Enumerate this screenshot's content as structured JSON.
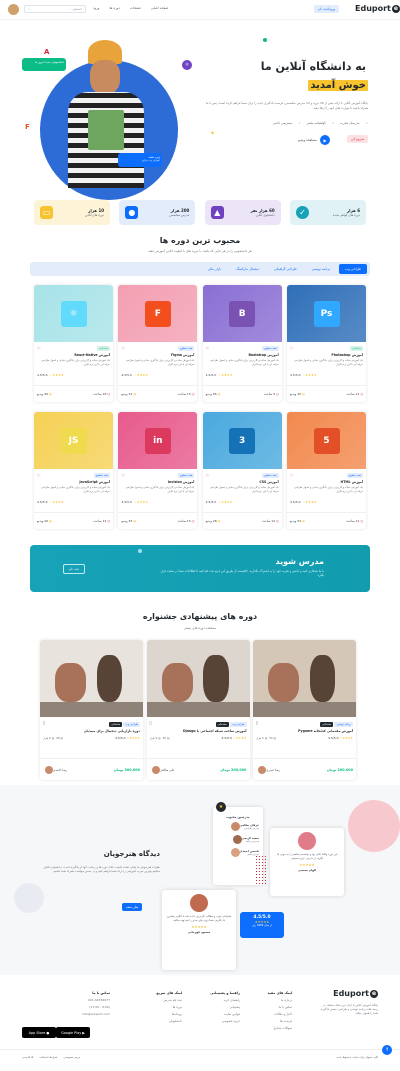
{
  "colors": {
    "primary": "#0d6efd",
    "danger": "#d6293e",
    "warning": "#f7c32e",
    "info": "#17a2b8",
    "purple": "#6f42c1",
    "success": "#0cbc87"
  },
  "header": {
    "logo": "Eduport",
    "login": "ورود/ثبت نام",
    "menu": [
      "صفحه اصلی",
      "صفحات",
      "دوره ها",
      "ورود"
    ],
    "search_placeholder": "جستجو...",
    "login_icon": "user-icon"
  },
  "hero": {
    "title_line1": "به دانشگاه آنلاین ما",
    "title_line2": "خوش آمدید",
    "paragraph": "پایگاه آموزش آنلاین با ارائه بیش از 30 دوره و 12 مدرس متخصص، فرصت یادگیری جدید را برای شما فراهم کرده است؛ پس با ما همراه باشید تا مهارت های خود را ارتقا دهید.",
    "checks": [
      "مدرسان مجرب",
      "گواهینامه معتبر",
      "دسترسی دائمی"
    ],
    "start_button": "شروع کن",
    "video_button": "مشاهده ویدیو",
    "badge_top": "دانشجویان جدید امروز ما",
    "badge_bottom": "دوره هفته",
    "badge_bottom_sub": "آموزش وب دیزاین"
  },
  "stats": [
    {
      "num": "10 هزار",
      "label": "دوره های آنلاین",
      "icon": "tv-icon",
      "color": "#fdf3d7",
      "icon_color": "#f7c32e"
    },
    {
      "num": "200 هزار",
      "label": "مدرس متخصص",
      "icon": "user-icon",
      "color": "#e2ecfb",
      "icon_color": "#0d6efd"
    },
    {
      "num": "60 هزار نفر",
      "label": "دانشجوی آنلاین",
      "icon": "graduation-icon",
      "color": "#ece5f7",
      "icon_color": "#6f42c1"
    },
    {
      "num": "6 هزار",
      "label": "دوره های گواهی شده",
      "icon": "badge-check-icon",
      "color": "#e0f2f5",
      "icon_color": "#17a2b8"
    }
  ],
  "popular": {
    "title": "محبوب ترین دوره ها",
    "subtitle": "هر دانشجویی را در هر جایی که باشد، با دوره های با کیفیت آنلاین آموزش دهید",
    "tabs": [
      "طراحی وب",
      "برنامه نویسی",
      "طراحی گرافیکی",
      "دیجیتال مارکتینگ",
      "بازار مالی"
    ],
    "active_tab": 0,
    "courses": [
      {
        "title": "آموزش Photoshop",
        "level": "مقدماتی",
        "desc": "یک آموزش ساده و کاربردی برای یادگیری مبانی و اصول طراحی حرفه ای با این نرم افزار",
        "rating": "4.5/5.0",
        "hours": "12 ساعت",
        "lectures": "20 ویدیو",
        "icon": "Ps",
        "icon_name": "photoshop-icon",
        "bg": "#2f6fb8",
        "fg": "#31a8ff",
        "lvl_bg": "#d4f2e7",
        "lvl_fg": "#0cbc87"
      },
      {
        "title": "آموزش Bootstrap",
        "level": "همه سطوح",
        "desc": "یک آموزش ساده و کاربردی برای یادگیری مبانی و اصول طراحی حرفه ای با این نرم افزار",
        "rating": "4.5/5.0",
        "hours": "9 ساعت",
        "lectures": "65 ویدیو",
        "icon": "B",
        "icon_name": "bootstrap-icon",
        "bg": "#8a6fd3",
        "fg": "#7952b3",
        "lvl_bg": "#e2ecfb",
        "lvl_fg": "#0d6efd"
      },
      {
        "title": "آموزش Figma",
        "level": "همه سطوح",
        "desc": "یک آموزش ساده و کاربردی برای یادگیری مبانی و اصول طراحی حرفه ای با این نرم افزار",
        "rating": "4.5/5.0",
        "hours": "15 ساعت",
        "lectures": "32 ویدیو",
        "icon": "F",
        "icon_name": "figma-icon",
        "bg": "#f39fb2",
        "fg": "#f24e1e",
        "lvl_bg": "#e2ecfb",
        "lvl_fg": "#0d6efd"
      },
      {
        "title": "آموزش React-Native",
        "level": "مقدماتی",
        "desc": "یک آموزش ساده و کاربردی برای یادگیری مبانی و اصول طراحی حرفه ای با این نرم افزار",
        "rating": "4.5/5.0",
        "hours": "18 ساعت",
        "lectures": "99 ویدیو",
        "icon": "⚛",
        "icon_name": "react-icon",
        "bg": "#a7e3e8",
        "fg": "#61dafb",
        "lvl_bg": "#d4f2e7",
        "lvl_fg": "#0cbc87"
      },
      {
        "title": "آموزش HTML",
        "level": "همه سطوح",
        "desc": "یک آموزش ساده و کاربردی برای یادگیری مبانی و اصول طراحی حرفه ای با این نرم افزار",
        "rating": "4.5/5.0",
        "hours": "11 ساعت",
        "lectures": "54 ویدیو",
        "icon": "5",
        "icon_name": "html5-icon",
        "bg": "#f2894e",
        "fg": "#e34f26",
        "lvl_bg": "#e2ecfb",
        "lvl_fg": "#0d6efd"
      },
      {
        "title": "آموزش CSS",
        "level": "همه سطوح",
        "desc": "یک آموزش ساده و کاربردی برای یادگیری مبانی و اصول طراحی حرفه ای با این نرم افزار",
        "rating": "4.5/5.0",
        "hours": "12 ساعت",
        "lectures": "28 ویدیو",
        "icon": "3",
        "icon_name": "css3-icon",
        "bg": "#4aa9de",
        "fg": "#1572b6",
        "lvl_bg": "#e2ecfb",
        "lvl_fg": "#0d6efd"
      },
      {
        "title": "آموزش Invision",
        "level": "همه سطوح",
        "desc": "یک آموزش ساده و کاربردی برای یادگیری مبانی و اصول طراحی حرفه ای با این نرم افزار",
        "rating": "4.5/5.0",
        "hours": "15 ساعت",
        "lectures": "45 ویدیو",
        "icon": "in",
        "icon_name": "invision-icon",
        "bg": "#e75a8c",
        "fg": "#dc395f",
        "lvl_bg": "#e2ecfb",
        "lvl_fg": "#0d6efd"
      },
      {
        "title": "آموزش JavaScript",
        "level": "همه سطوح",
        "desc": "یک آموزش ساده و کاربردی برای یادگیری مبانی و اصول طراحی حرفه ای با این نرم افزار",
        "rating": "4.5/5.0",
        "hours": "12 ساعت",
        "lectures": "20 ویدیو",
        "icon": "JS",
        "icon_name": "javascript-icon",
        "bg": "#f5d155",
        "fg": "#f0db4f",
        "lvl_bg": "#e2ecfb",
        "lvl_fg": "#0d6efd"
      }
    ]
  },
  "banner": {
    "title": "مدرس شوید",
    "text": "با ما همکاری کنید و دانش و تجربه خود را به اشتراک بگذارید. کافیست از طریق این فرم ثبت نام کنید تا اطلاعات شما در سایت قرار بگیرد.",
    "button": "ثبت نام"
  },
  "featured": {
    "title": "دوره های پیشنهادی جشنواره",
    "subtitle": "مشاهده دوره های بیشتر",
    "courses": [
      {
        "category": "طراحی وب",
        "level": "مقدماتی",
        "title": "دوره بازاریابی دیجیتال برای مبتدیان",
        "rating": "4.5/5.0",
        "students": "6 هزار",
        "lectures": "28",
        "instructor": "رضا احمدی",
        "price": "300,000 تومان",
        "img": "#e8e3dc"
      },
      {
        "category": "طراحی وب",
        "level": "مقدماتی",
        "title": "آموزش ساخت شبکه اجتماعی با Django",
        "rating": "4.5/5.0",
        "students": "9 هزار",
        "lectures": "40",
        "instructor": "علی صالحی",
        "price": "200,000 تومان",
        "img": "#dcd6cf"
      },
      {
        "category": "برنامه نویسی",
        "level": "مقدماتی",
        "title": "آموزش مقدماتی کتابخانه Pygame",
        "rating": "4.5/5.0",
        "students": "5 هزار",
        "lectures": "30",
        "instructor": "رضا حیدری",
        "price": "200,000 تومان",
        "img": "#d4c7b8"
      }
    ]
  },
  "testimonials": {
    "title": "دیدگاه هنرجویان",
    "text": "نظرات هنرجویان ما نشان دهنده کیفیت بالای دوره ها و رضایت آنها از یادگیری است. ما همواره تلاش میکنیم بهترین تجربه آموزشی را برای شما فراهم کنیم و در مسیر موفقیت همراه شما باشیم.",
    "button": "نظر بدهید",
    "card1_text": "این دوره واقعا عالی بود و توانستم مفاهیم را به خوبی یاد بگیرم. از مدرس عزیز ممنونم.",
    "card1_name": "الهام حسینی",
    "card2_text": "پشتیبانی خوب و مطالب کاربردی باعث شد با انگیزه بیشتری یاد بگیرم. حتما دوره های بعدی را هم تهیه میکنم.",
    "card2_name": "مسعود قهرمانی",
    "rating_box": "4.5/5.0",
    "rating_box_sub": "از میان 3265 رای",
    "mentors_title": "مدرسین محبوب",
    "mentors": [
      {
        "name": "عرفان نظامی",
        "role": "مدرس طراحی"
      },
      {
        "name": "سعید کریمی",
        "role": "مدرس برنامه"
      },
      {
        "name": "یاسمن احمدی",
        "role": "مدرس سئو"
      }
    ]
  },
  "footer": {
    "logo": "Eduport",
    "about": "پایگاه آموزش آنلاین با ارائه دوره های مختلف در زمینه های برنامه نویسی و طراحی، مسیر یادگیری شما را هموار میکند.",
    "col1_title": "لینک های مفید",
    "col1": [
      "درباره ما",
      "تماس با ما",
      "اخبار و مقالات",
      "فرصت ها",
      "سوالات متداول"
    ],
    "col2_title": "راهنما و پشتیبانی",
    "col2": [
      "راهنمای خرید",
      "پشتیبانی",
      "قوانین سایت",
      "حریم خصوصی"
    ],
    "col3_title": "لینک های سریع",
    "col3": [
      "ثبت نام مدرس",
      "دوره ها",
      "رویدادها",
      "دانشجویان"
    ],
    "col4_title": "تماس با ما",
    "phone": "021-44556677",
    "hours": "(9:00 - 17:00)",
    "email": "info@eduport.com",
    "appstore": "App Store",
    "googleplay": "Google Play",
    "copyright": "کلیه حقوق برای سایت محفوظ است",
    "bottom_links": [
      "شرایط استفاده",
      "حریم خصوصی"
    ],
    "lang": "فارسی"
  }
}
